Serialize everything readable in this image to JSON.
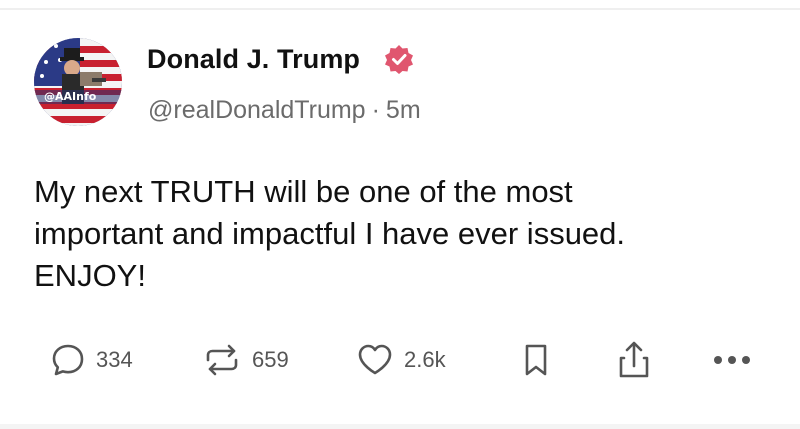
{
  "post": {
    "author_name": "Donald J. Trump",
    "handle": "@realDonaldTrump",
    "separator": "·",
    "time_ago": "5m",
    "text_lines": [
      "My next TRUTH will be one of the most",
      "important and impactful I have ever issued.",
      "ENJOY!"
    ],
    "verified": true,
    "avatar_overlay_text": "@AAInfo"
  },
  "actions": {
    "reply": {
      "icon": "speech-bubble-icon",
      "count": "334"
    },
    "retruth": {
      "icon": "repost-arrows-icon",
      "count": "659"
    },
    "like": {
      "icon": "heart-icon",
      "count": "2.6k"
    },
    "bookmark": {
      "icon": "bookmark-icon"
    },
    "share": {
      "icon": "share-upload-icon"
    },
    "more": {
      "icon": "more-dots-icon"
    }
  },
  "colors": {
    "verified_badge": "#e0566f",
    "text": "#111111",
    "muted": "#6b6b6b",
    "icon": "#555555"
  }
}
